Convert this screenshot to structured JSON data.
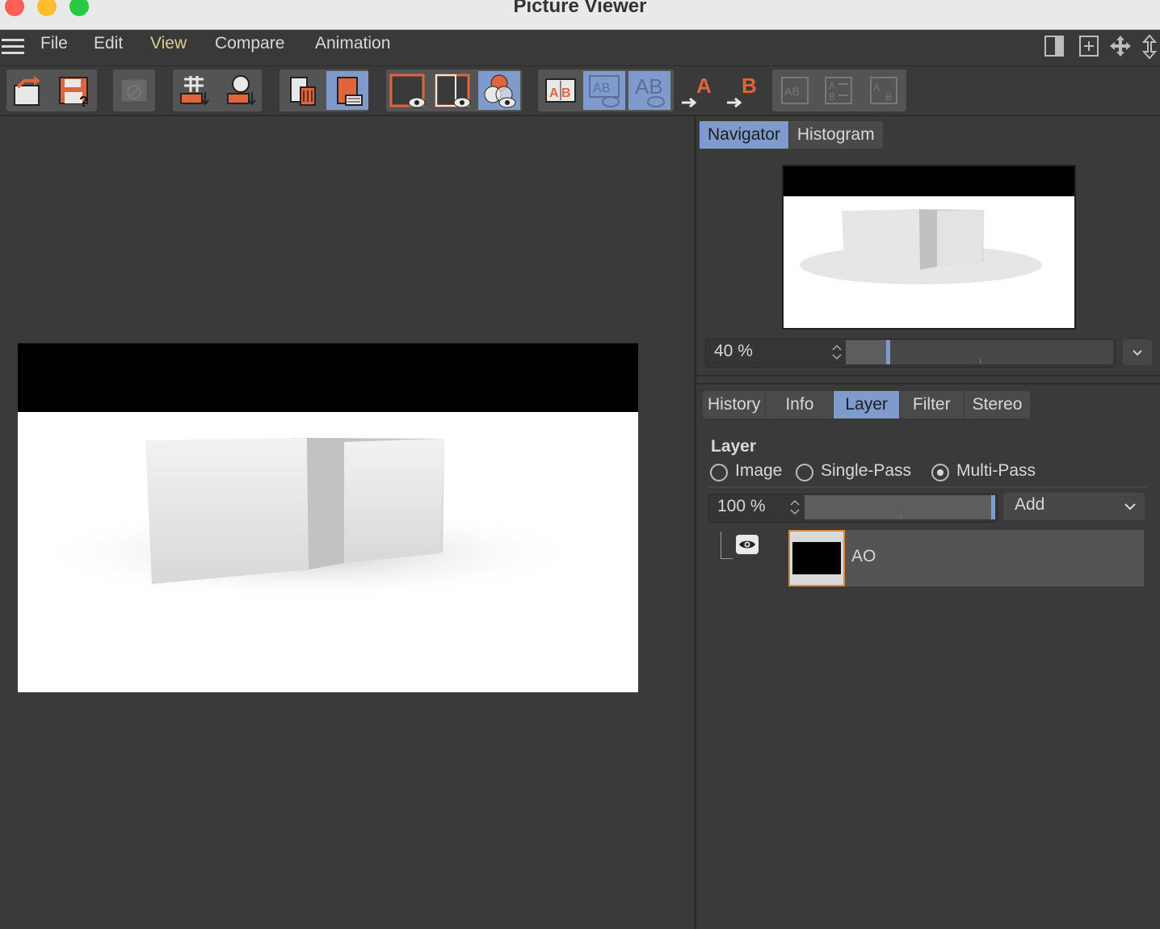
{
  "window": {
    "title": "Picture Viewer"
  },
  "menu": [
    {
      "label": "File"
    },
    {
      "label": "Edit"
    },
    {
      "label": "View"
    },
    {
      "label": "Compare"
    },
    {
      "label": "Animation"
    }
  ],
  "navigator": {
    "tabs": [
      "Navigator",
      "Histogram"
    ],
    "zoom_value": "40 %"
  },
  "bottom_panel": {
    "tabs": [
      "History",
      "Info",
      "Layer",
      "Filter",
      "Stereo"
    ],
    "section_title": "Layer",
    "radios": [
      "Image",
      "Single-Pass",
      "Multi-Pass"
    ],
    "opacity_value": "100 %",
    "blend_mode": "Add",
    "layers": [
      {
        "name": "AO"
      }
    ]
  },
  "colors": {
    "accent_blue": "#7f9bcd",
    "icon_orange": "#e0643c",
    "active_menu": "#d8d08a"
  }
}
